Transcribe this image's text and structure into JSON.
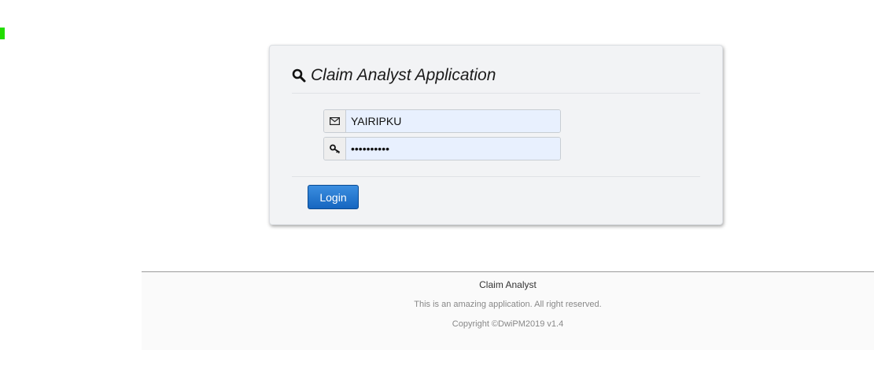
{
  "app": {
    "title": "Claim Analyst Application"
  },
  "login_form": {
    "username": {
      "value": "YAIRIPKU",
      "icon": "envelope-icon"
    },
    "password": {
      "value": "••••••••••",
      "icon": "key-icon"
    },
    "submit_label": "Login"
  },
  "footer": {
    "title": "Claim Analyst",
    "tagline": "This is an amazing application. All right reserved.",
    "copyright": "Copyright ©DwiPM2019 v1.4"
  },
  "colors": {
    "accent": "#1666c0",
    "panel_bg": "#f2f3f5",
    "input_bg": "#e8f0fe",
    "status_mark": "#22dd00"
  }
}
